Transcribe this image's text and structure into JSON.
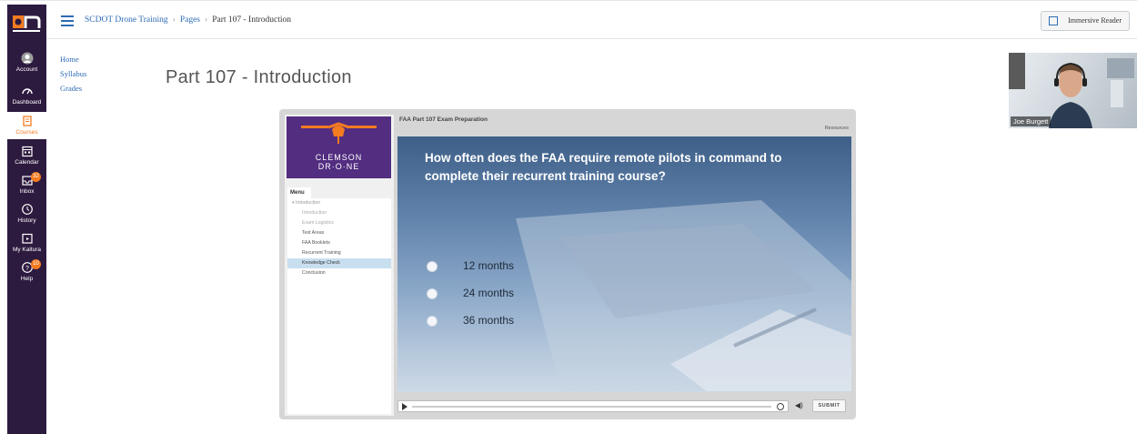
{
  "global_nav": {
    "logo": "on",
    "items": [
      {
        "label": "Account",
        "icon": "account-icon"
      },
      {
        "label": "Dashboard",
        "icon": "dashboard-icon"
      },
      {
        "label": "Courses",
        "icon": "courses-icon",
        "active": true
      },
      {
        "label": "Calendar",
        "icon": "calendar-icon"
      },
      {
        "label": "Inbox",
        "icon": "inbox-icon",
        "badge": "32"
      },
      {
        "label": "History",
        "icon": "history-icon"
      },
      {
        "label": "My Kaltura",
        "icon": "kaltura-icon"
      },
      {
        "label": "Help",
        "icon": "help-icon",
        "badge": "10"
      }
    ],
    "accent": "#f47b20",
    "bg": "#2d1a3f"
  },
  "header": {
    "breadcrumbs": [
      "SCDOT Drone Training",
      "Pages",
      "Part 107 - Introduction"
    ],
    "immersive_reader": "Immersive Reader"
  },
  "course_nav": [
    "Home",
    "Syllabus",
    "Grades"
  ],
  "page_title": "Part 107 - Introduction",
  "webcam": {
    "name": "Joe Burgett"
  },
  "player": {
    "logo_line1": "CLEMSON",
    "logo_line2": "DR·O·NE",
    "title": "FAA Part 107 Exam Preparation",
    "resources": "Resources",
    "menu_tab": "Menu",
    "menu": [
      {
        "label": "Introduction",
        "level": "top"
      },
      {
        "label": "Introduction",
        "state": "dim"
      },
      {
        "label": "Exam Logistics",
        "state": "dim"
      },
      {
        "label": "Test Areas",
        "state": "normal"
      },
      {
        "label": "FAA Booklets",
        "state": "normal"
      },
      {
        "label": "Recurrent Training",
        "state": "normal"
      },
      {
        "label": "Knowledge Check",
        "state": "selected"
      },
      {
        "label": "Conclusion",
        "state": "normal"
      }
    ],
    "question": "How often does the FAA require remote pilots in command to complete their recurrent training course?",
    "options": [
      "12 months",
      "24 months",
      "36 months"
    ],
    "submit": "SUBMIT"
  }
}
